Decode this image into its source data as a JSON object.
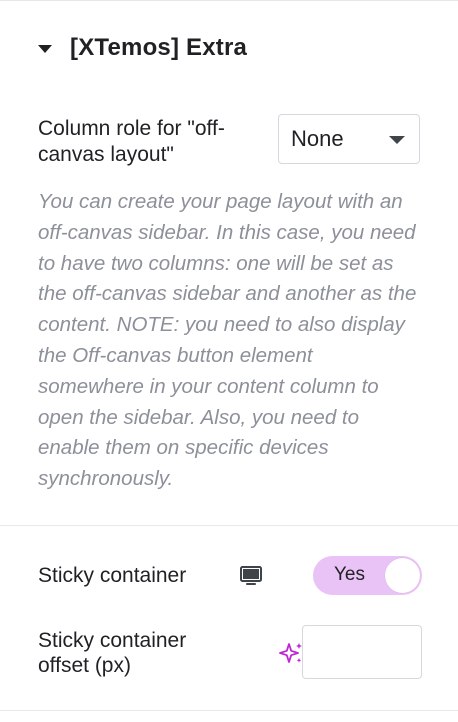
{
  "section": {
    "title": "[XTemos] Extra"
  },
  "column_role": {
    "label": "Column role for \"off-canvas layout\"",
    "selected": "None",
    "help": "You can create your page layout with an off-canvas sidebar. In this case, you need to have two columns: one will be set as the off-canvas sidebar and another as the content. NOTE: you need to also display the Off-canvas button element somewhere in your content column to open the sidebar. Also, you need to enable them on specific devices synchronously."
  },
  "sticky": {
    "label": "Sticky container",
    "device_icon": "desktop-monitor-icon",
    "toggle_label": "Yes",
    "toggle_on": true,
    "toggle_color": "#e9c3f5"
  },
  "offset": {
    "label": "Sticky container offset (px)",
    "ai_icon": "sparkle-icon",
    "ai_icon_color": "#c026d3",
    "value": ""
  }
}
